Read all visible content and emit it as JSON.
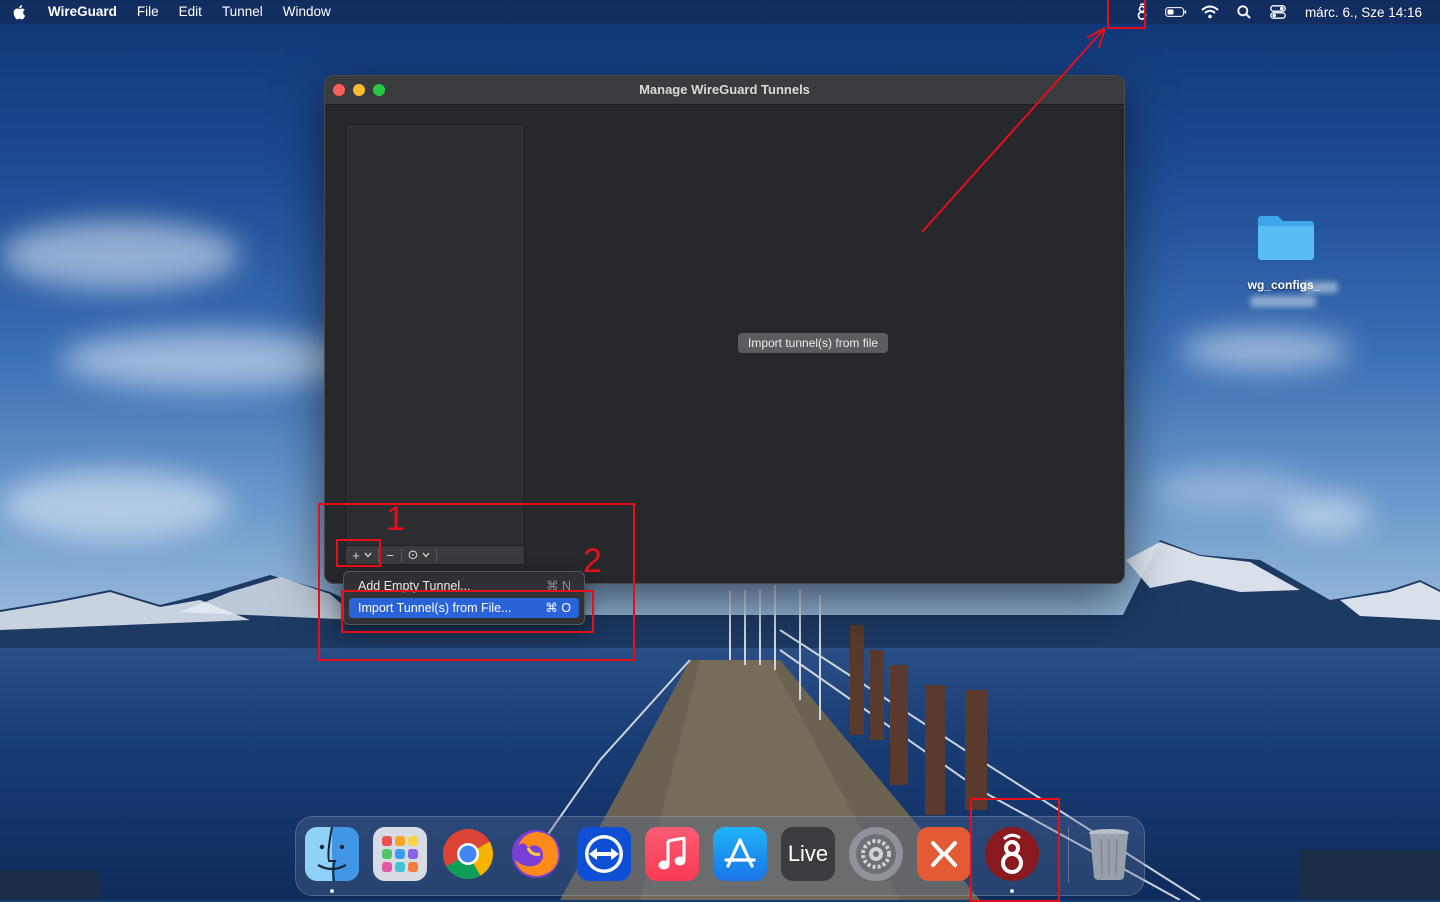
{
  "menubar": {
    "app_name": "WireGuard",
    "menus": [
      "File",
      "Edit",
      "Tunnel",
      "Window"
    ],
    "clock": "márc. 6., Sze  14:16",
    "status_icons": [
      "wireguard-icon",
      "battery-icon",
      "wifi-icon",
      "search-icon",
      "control-center-icon"
    ]
  },
  "window": {
    "title": "Manage WireGuard Tunnels",
    "import_button": "Import tunnel(s) from file",
    "toolbar": {
      "add": "+",
      "remove": "−",
      "more": "⊙"
    }
  },
  "dropdown": {
    "items": [
      {
        "label": "Add Empty Tunnel...",
        "shortcut": "⌘ N",
        "highlighted": false
      },
      {
        "label": "Import Tunnel(s) from File...",
        "shortcut": "⌘ O",
        "highlighted": true
      }
    ]
  },
  "annotations": {
    "step1": "1",
    "step2": "2"
  },
  "desktop": {
    "folder_label": "wg_configs_"
  },
  "dock": {
    "apps": [
      "Finder",
      "Launchpad",
      "Chrome",
      "Firefox",
      "TeamViewer",
      "Music",
      "App Store",
      "Live",
      "System Settings",
      "Remote Desktop",
      "WireGuard",
      "Trash"
    ],
    "live_label": "Live"
  },
  "colors": {
    "accent": "#2a63d8",
    "annotation": "#e3101a",
    "window_bg": "#27282b"
  }
}
